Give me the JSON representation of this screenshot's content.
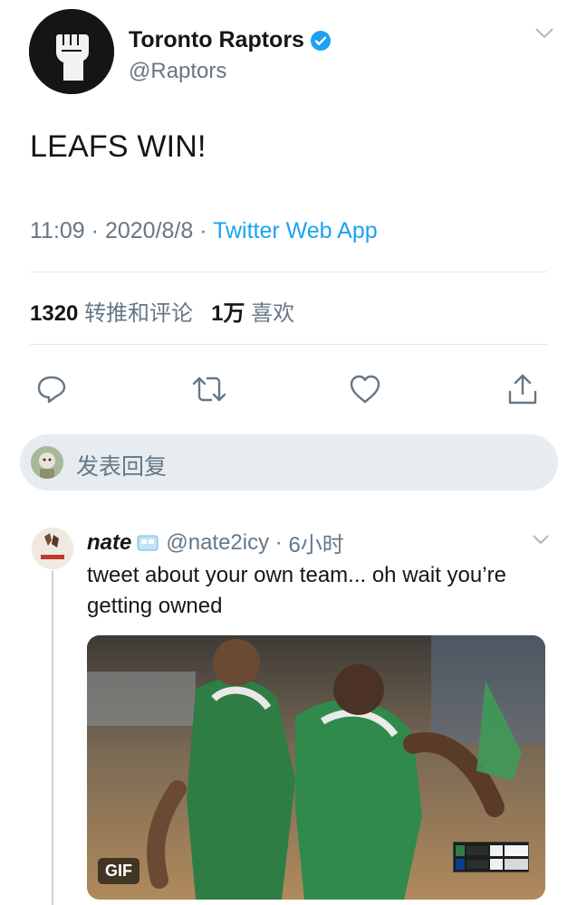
{
  "tweet": {
    "author_name": "Toronto Raptors",
    "author_handle": "@Raptors",
    "text": "LEAFS WIN!",
    "time": "11:09",
    "date": "2020/8/8",
    "source": "Twitter Web App",
    "retweets_count": "1320",
    "retweets_label": "转推和评论",
    "likes_count": "1万",
    "likes_label": "喜欢"
  },
  "reply_box": {
    "placeholder": "发表回复"
  },
  "reply": {
    "name": "nate",
    "handle": "@nate2icy",
    "time": "6小时",
    "text": "tweet about your own team... oh wait you’re getting owned",
    "media_badge": "GIF"
  },
  "icons": [
    "verified-badge-icon",
    "chevron-down-icon",
    "reply-icon",
    "retweet-icon",
    "like-icon",
    "share-icon"
  ],
  "colors": {
    "accent": "#1da1f2",
    "text": "#14171a",
    "secondary": "#657786",
    "divider": "#e1e8ed",
    "reply_box_bg": "#e6ecf0"
  }
}
